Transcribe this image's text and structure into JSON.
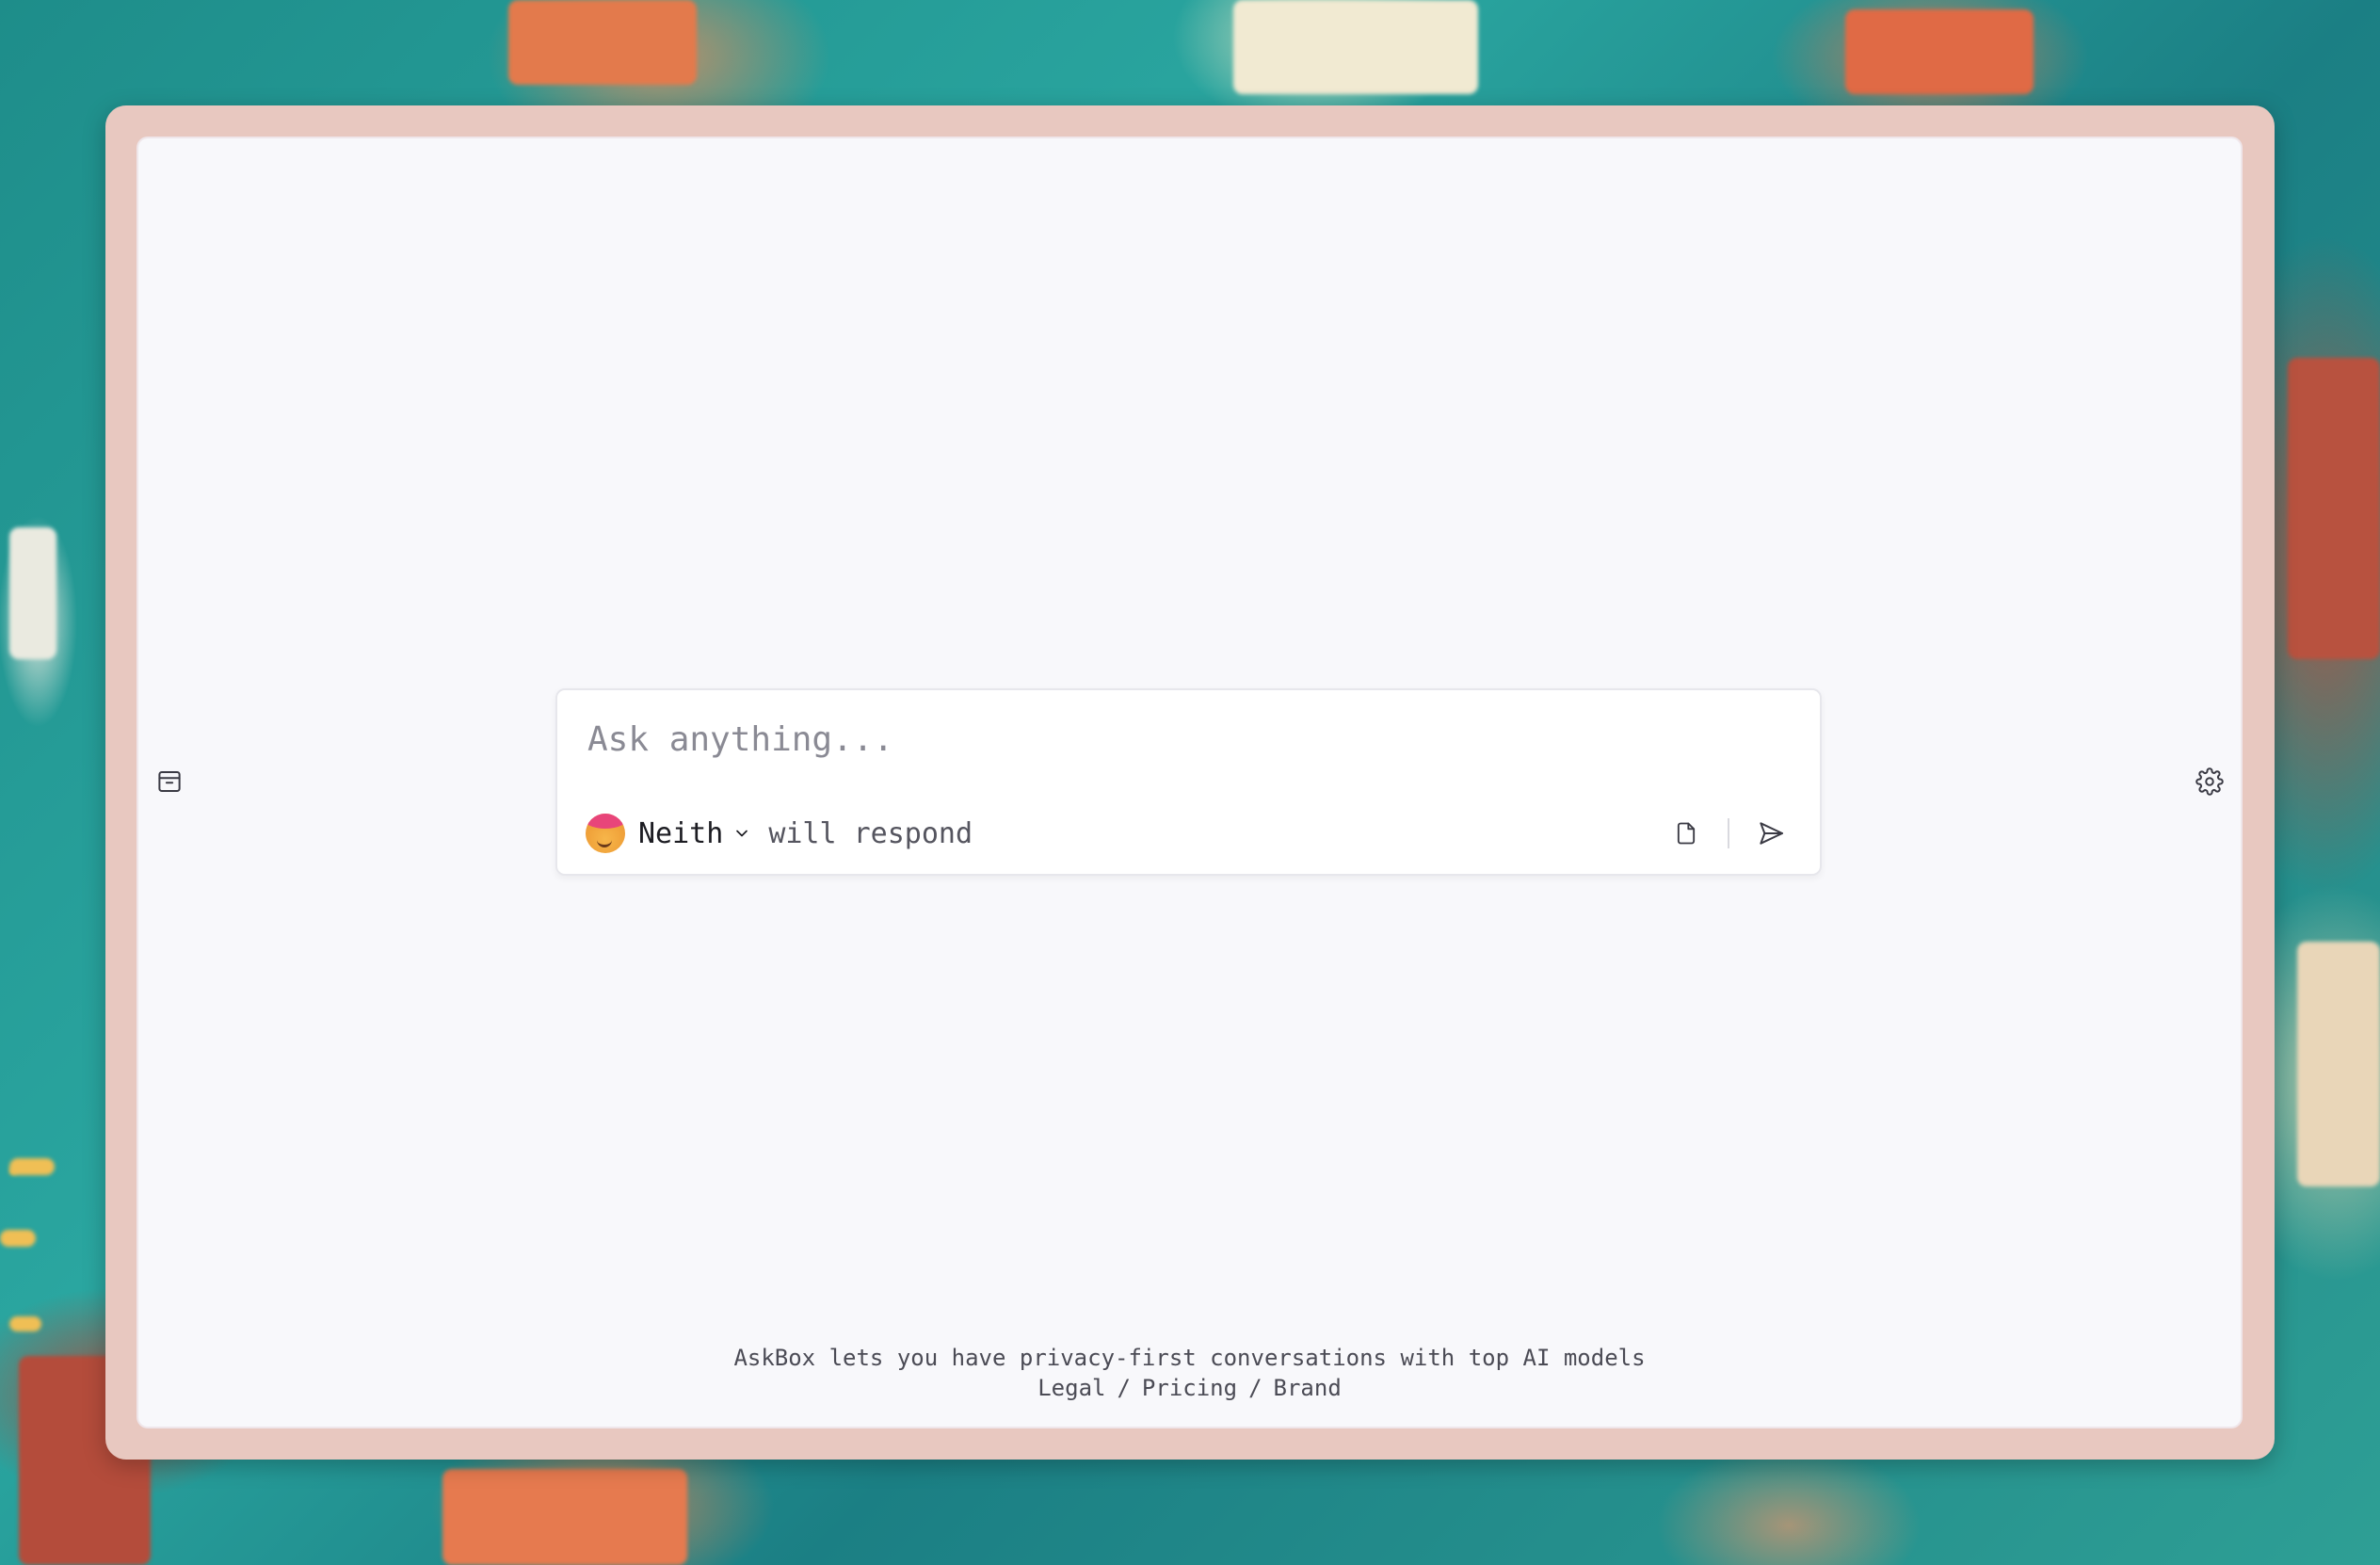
{
  "composer": {
    "placeholder": "Ask anything...",
    "model_name": "Neith",
    "respond_suffix": "will respond"
  },
  "footer": {
    "tagline": "AskBox lets you have privacy-first conversations with top AI models",
    "links": [
      "Legal",
      "Pricing",
      "Brand"
    ],
    "separator": "/"
  },
  "icons": {
    "left_sidebar": "archive-icon",
    "right_sidebar": "gear-icon",
    "attach": "file-icon",
    "send": "send-icon",
    "model_dropdown": "chevron-down-icon"
  },
  "colors": {
    "frame": "#e8c8c0",
    "panel": "#f8f8fb",
    "composer_border": "#e7e7ec"
  }
}
